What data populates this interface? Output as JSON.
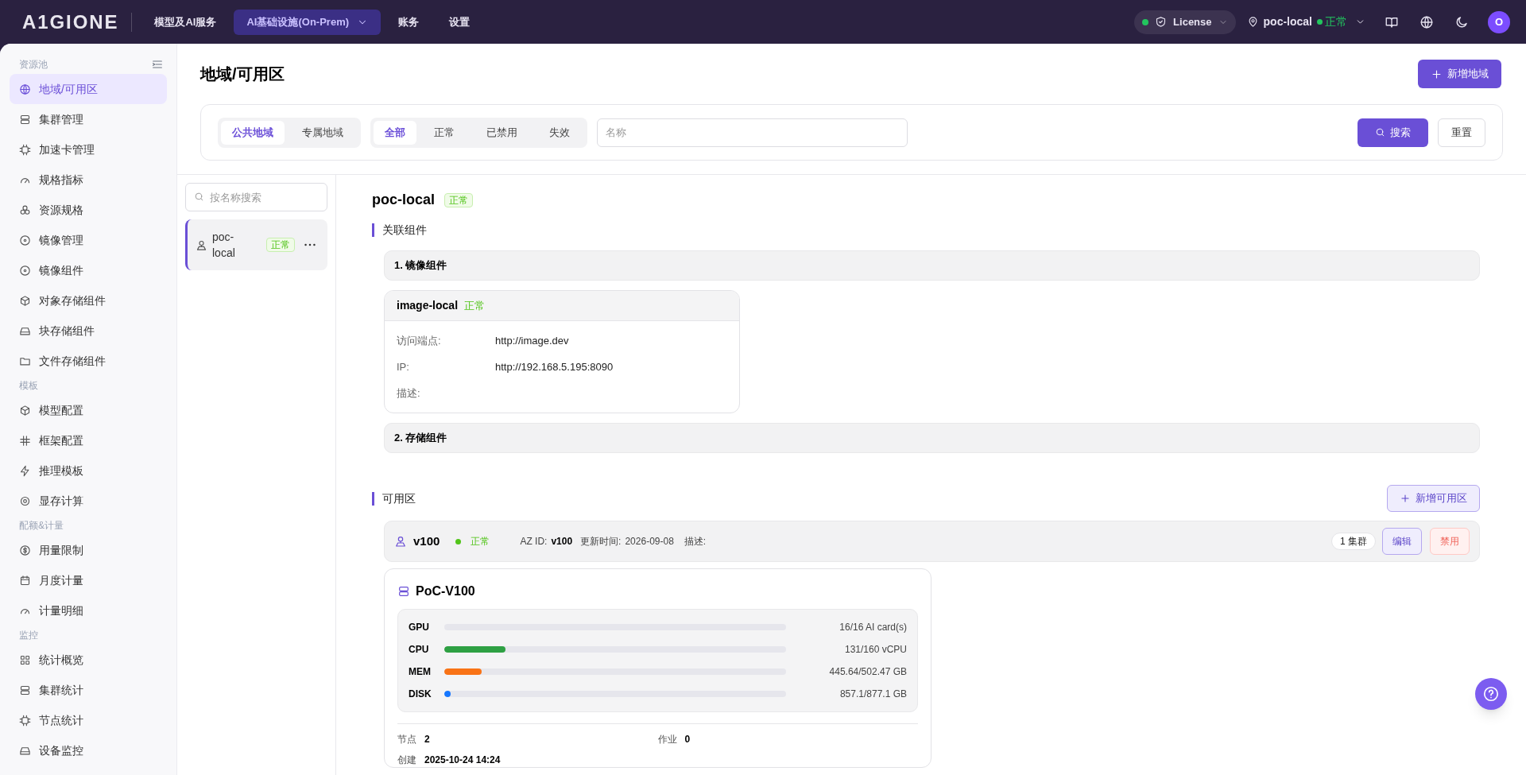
{
  "topbar": {
    "logo": "A1GIONE",
    "nav": [
      {
        "label": "模型及AI服务",
        "selected": false,
        "dropdown": false
      },
      {
        "label": "AI基础设施(On-Prem)",
        "selected": true,
        "dropdown": true
      },
      {
        "label": "账务",
        "selected": false,
        "dropdown": false
      },
      {
        "label": "设置",
        "selected": false,
        "dropdown": false
      }
    ],
    "license": {
      "label": "License",
      "active": true
    },
    "location": {
      "name": "poc-local",
      "status": "正常"
    },
    "avatar": "O"
  },
  "sidebar": {
    "sections": [
      {
        "title": "资源池",
        "items": [
          {
            "label": "地域/可用区",
            "selected": true
          },
          {
            "label": "集群管理",
            "selected": false
          },
          {
            "label": "加速卡管理",
            "selected": false
          },
          {
            "label": "规格指标",
            "selected": false
          },
          {
            "label": "资源规格",
            "selected": false
          },
          {
            "label": "镜像管理",
            "selected": false
          },
          {
            "label": "镜像组件",
            "selected": false
          },
          {
            "label": "对象存储组件",
            "selected": false
          },
          {
            "label": "块存储组件",
            "selected": false
          },
          {
            "label": "文件存储组件",
            "selected": false
          }
        ]
      },
      {
        "title": "模板",
        "items": [
          {
            "label": "模型配置",
            "selected": false
          },
          {
            "label": "框架配置",
            "selected": false
          },
          {
            "label": "推理模板",
            "selected": false
          },
          {
            "label": "显存计算",
            "selected": false
          }
        ]
      },
      {
        "title": "配额&计量",
        "items": [
          {
            "label": "用量限制",
            "selected": false
          },
          {
            "label": "月度计量",
            "selected": false
          },
          {
            "label": "计量明细",
            "selected": false
          }
        ]
      },
      {
        "title": "监控",
        "items": [
          {
            "label": "统计概览",
            "selected": false
          },
          {
            "label": "集群统计",
            "selected": false
          },
          {
            "label": "节点统计",
            "selected": false
          },
          {
            "label": "设备监控",
            "selected": false
          }
        ]
      }
    ]
  },
  "page": {
    "title": "地域/可用区",
    "add_button": "新增地域"
  },
  "filters": {
    "scope_tabs": [
      {
        "label": "公共地域",
        "selected": true
      },
      {
        "label": "专属地域",
        "selected": false
      }
    ],
    "status_tabs": [
      {
        "label": "全部",
        "selected": true
      },
      {
        "label": "正常",
        "selected": false
      },
      {
        "label": "已禁用",
        "selected": false
      },
      {
        "label": "失效",
        "selected": false
      }
    ],
    "name_field": {
      "placeholder": "名称"
    },
    "search_button": "搜索",
    "reset_button": "重置"
  },
  "region_list": {
    "search": {
      "placeholder": "按名称搜索"
    },
    "items": [
      {
        "name": "poc-\nlocal",
        "status": "正常",
        "selected": true
      }
    ]
  },
  "detail": {
    "title": "poc-local",
    "status": "正常",
    "components_heading": "关联组件",
    "groups": [
      {
        "title": "1. 镜像组件",
        "cards": [
          {
            "name": "image-local",
            "status": "正常",
            "fields": [
              {
                "label": "访问端点:",
                "value": "http://image.dev"
              },
              {
                "label": "IP:",
                "value": "http://192.168.5.195:8090"
              },
              {
                "label": "描述:"
              }
            ]
          }
        ]
      },
      {
        "title": "2. 存储组件"
      }
    ],
    "az_heading": "可用区",
    "add_az_button": "新增可用区",
    "zones": [
      {
        "name": "v100",
        "status": "正常",
        "active": true,
        "az_id_label": "AZ ID:",
        "az_id": "v100",
        "updated_label": "更新时间:",
        "updated": "2026-09-08",
        "desc_label": "描述:",
        "cluster_count": "1 集群",
        "edit_button": "编辑",
        "disable_button": "禁用",
        "clusters": [
          {
            "name": "PoC-V100",
            "resources": [
              {
                "label": "GPU",
                "level": 0,
                "reading": "16/16 AI card(s)"
              },
              {
                "label": "CPU",
                "level": 0.18,
                "reading": "131/160 vCPU",
                "color": "#2ea043"
              },
              {
                "label": "MEM",
                "level": 0.11,
                "reading": "445.64/502.47 GB",
                "color": "#f97316"
              },
              {
                "label": "DISK",
                "level": 0.018,
                "reading": "857.1/877.1 GB",
                "color": "#1677ff"
              }
            ],
            "stats": [
              {
                "label": "节点",
                "value": "2"
              },
              {
                "label": "作业",
                "value": "0"
              },
              {
                "label": "创建",
                "value": "2025-10-24 14:24"
              }
            ]
          }
        ]
      }
    ]
  }
}
